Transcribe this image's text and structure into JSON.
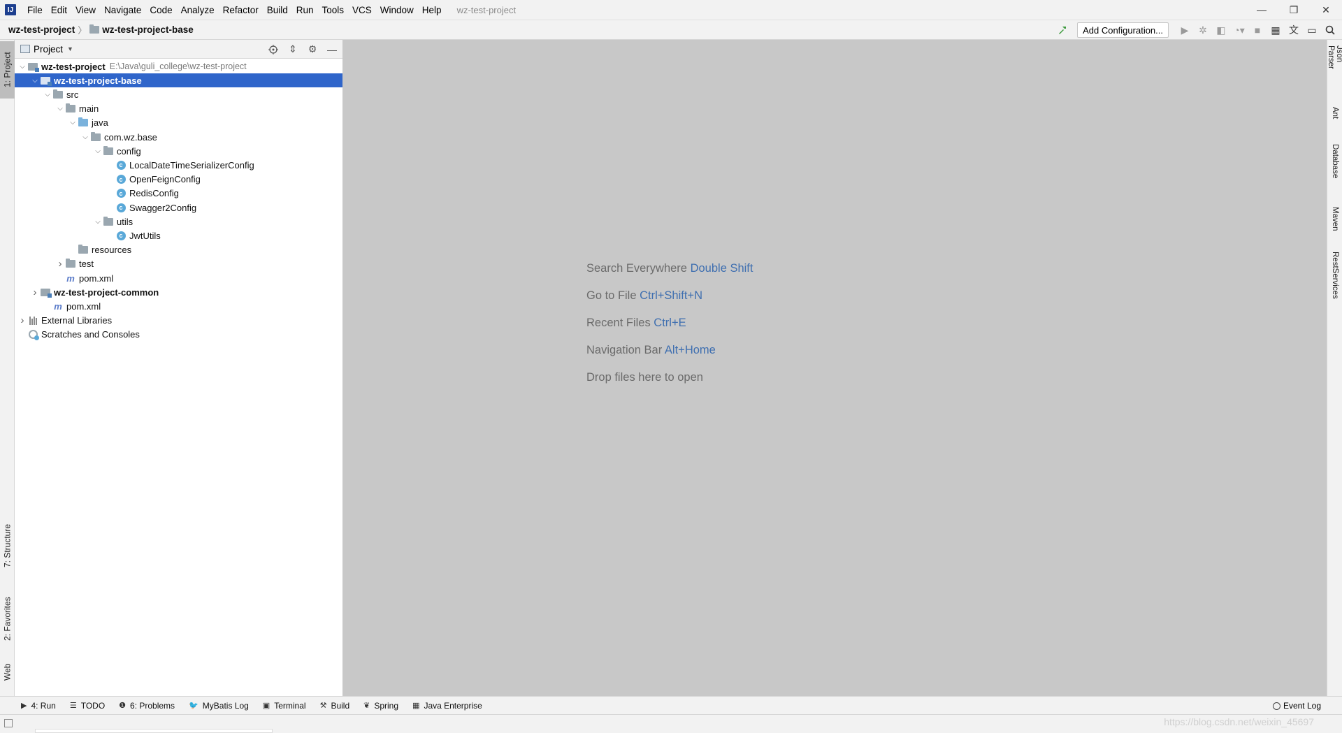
{
  "app": {
    "logo": "IJ",
    "window_title": "wz-test-project"
  },
  "menu": [
    "File",
    "Edit",
    "View",
    "Navigate",
    "Code",
    "Analyze",
    "Refactor",
    "Build",
    "Run",
    "Tools",
    "VCS",
    "Window",
    "Help"
  ],
  "window_controls": {
    "minimize": "—",
    "restore": "❐",
    "close": "✕"
  },
  "navbar": {
    "crumbs": [
      "wz-test-project",
      "wz-test-project-base"
    ],
    "separator": "〉",
    "add_config": "Add Configuration..."
  },
  "icons": {
    "hammer": "hammer-icon",
    "run": "run-icon",
    "debug": "debug-icon",
    "coverage": "coverage-icon",
    "profile": "profile-icon",
    "stop": "stop-icon",
    "project-structure": "project-structure-icon",
    "translate": "translate-icon",
    "layout": "layout-icon",
    "search": "search-icon"
  },
  "left_tabs": [
    "1: Project",
    "7: Structure",
    "2: Favorites",
    "Web"
  ],
  "right_tabs": [
    "Json Parser",
    "Ant",
    "Database",
    "Maven",
    "RestServices"
  ],
  "project_panel": {
    "title": "Project",
    "tree": [
      {
        "label": "wz-test-project",
        "path": "E:\\Java\\guli_college\\wz-test-project",
        "indent": 0,
        "arrow": "v",
        "icon": "module",
        "bold": true
      },
      {
        "label": "wz-test-project-base",
        "indent": 1,
        "arrow": "v",
        "icon": "module",
        "bold": true,
        "selected": true
      },
      {
        "label": "src",
        "indent": 2,
        "arrow": "v",
        "icon": "folder"
      },
      {
        "label": "main",
        "indent": 3,
        "arrow": "v",
        "icon": "folder"
      },
      {
        "label": "java",
        "indent": 4,
        "arrow": "v",
        "icon": "folder-src"
      },
      {
        "label": "com.wz.base",
        "indent": 5,
        "arrow": "v",
        "icon": "folder"
      },
      {
        "label": "config",
        "indent": 6,
        "arrow": "v",
        "icon": "folder"
      },
      {
        "label": "LocalDateTimeSerializerConfig",
        "indent": 7,
        "arrow": "",
        "icon": "class"
      },
      {
        "label": "OpenFeignConfig",
        "indent": 7,
        "arrow": "",
        "icon": "class"
      },
      {
        "label": "RedisConfig",
        "indent": 7,
        "arrow": "",
        "icon": "class"
      },
      {
        "label": "Swagger2Config",
        "indent": 7,
        "arrow": "",
        "icon": "class"
      },
      {
        "label": "utils",
        "indent": 6,
        "arrow": "v",
        "icon": "folder"
      },
      {
        "label": "JwtUtils",
        "indent": 7,
        "arrow": "",
        "icon": "class"
      },
      {
        "label": "resources",
        "indent": 4,
        "arrow": "",
        "icon": "folder"
      },
      {
        "label": "test",
        "indent": 3,
        "arrow": ">",
        "icon": "folder"
      },
      {
        "label": "pom.xml",
        "indent": 3,
        "arrow": "",
        "icon": "maven"
      },
      {
        "label": "wz-test-project-common",
        "indent": 1,
        "arrow": ">",
        "icon": "module",
        "bold": true
      },
      {
        "label": "pom.xml",
        "indent": 2,
        "arrow": "",
        "icon": "maven"
      },
      {
        "label": "External Libraries",
        "indent": 0,
        "arrow": ">",
        "icon": "lib"
      },
      {
        "label": "Scratches and Consoles",
        "indent": 0,
        "arrow": "",
        "icon": "scratch"
      }
    ]
  },
  "editor_hints": [
    {
      "text": "Search Everywhere",
      "key": "Double Shift"
    },
    {
      "text": "Go to File",
      "key": "Ctrl+Shift+N"
    },
    {
      "text": "Recent Files",
      "key": "Ctrl+E"
    },
    {
      "text": "Navigation Bar",
      "key": "Alt+Home"
    },
    {
      "text": "Drop files here to open",
      "key": ""
    }
  ],
  "bottom_tabs": [
    {
      "icon": "▶",
      "label": "4: Run"
    },
    {
      "icon": "☰",
      "label": "TODO"
    },
    {
      "icon": "❶",
      "label": "6: Problems"
    },
    {
      "icon": "🐦",
      "label": "MyBatis Log"
    },
    {
      "icon": "▣",
      "label": "Terminal"
    },
    {
      "icon": "⚒",
      "label": "Build"
    },
    {
      "icon": "❦",
      "label": "Spring"
    },
    {
      "icon": "▦",
      "label": "Java Enterprise"
    }
  ],
  "event_log": "Event Log",
  "watermark": "https://blog.csdn.net/weixin_45697"
}
